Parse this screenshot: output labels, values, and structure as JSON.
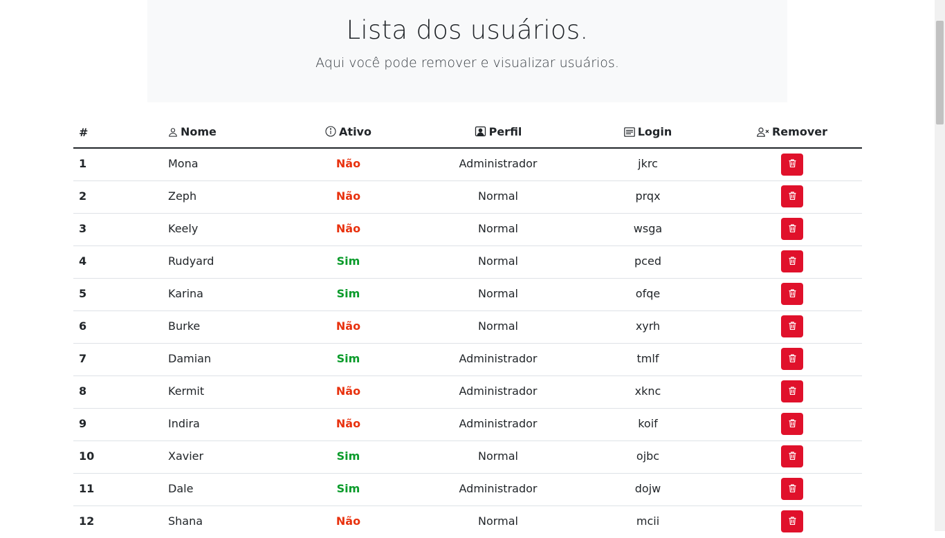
{
  "header": {
    "title": "Lista dos usuários.",
    "subtitle": "Aqui você pode remover e visualizar usuários."
  },
  "table": {
    "columns": {
      "num": "#",
      "nome": "Nome",
      "ativo": "Ativo",
      "perfil": "Perfil",
      "login": "Login",
      "remover": "Remover"
    },
    "rows": [
      {
        "id": "1",
        "nome": "Mona",
        "ativo": "Não",
        "perfil": "Administrador",
        "login": "jkrc"
      },
      {
        "id": "2",
        "nome": "Zeph",
        "ativo": "Não",
        "perfil": "Normal",
        "login": "prqx"
      },
      {
        "id": "3",
        "nome": "Keely",
        "ativo": "Não",
        "perfil": "Normal",
        "login": "wsga"
      },
      {
        "id": "4",
        "nome": "Rudyard",
        "ativo": "Sim",
        "perfil": "Normal",
        "login": "pced"
      },
      {
        "id": "5",
        "nome": "Karina",
        "ativo": "Sim",
        "perfil": "Normal",
        "login": "ofqe"
      },
      {
        "id": "6",
        "nome": "Burke",
        "ativo": "Não",
        "perfil": "Normal",
        "login": "xyrh"
      },
      {
        "id": "7",
        "nome": "Damian",
        "ativo": "Sim",
        "perfil": "Administrador",
        "login": "tmlf"
      },
      {
        "id": "8",
        "nome": "Kermit",
        "ativo": "Não",
        "perfil": "Administrador",
        "login": "xknc"
      },
      {
        "id": "9",
        "nome": "Indira",
        "ativo": "Não",
        "perfil": "Administrador",
        "login": "koif"
      },
      {
        "id": "10",
        "nome": "Xavier",
        "ativo": "Sim",
        "perfil": "Normal",
        "login": "ojbc"
      },
      {
        "id": "11",
        "nome": "Dale",
        "ativo": "Sim",
        "perfil": "Administrador",
        "login": "dojw"
      },
      {
        "id": "12",
        "nome": "Shana",
        "ativo": "Não",
        "perfil": "Normal",
        "login": "mcii"
      }
    ]
  },
  "icons": {
    "nome": "person-icon",
    "ativo": "info-circle-icon",
    "perfil": "person-badge-icon",
    "login": "card-text-icon",
    "remover": "person-x-icon",
    "delete": "trash-icon"
  },
  "colors": {
    "yes": "#0a9b2b",
    "no": "#e8320f",
    "delete_button": "#e0112b",
    "hero_bg": "#f8f9fa"
  }
}
